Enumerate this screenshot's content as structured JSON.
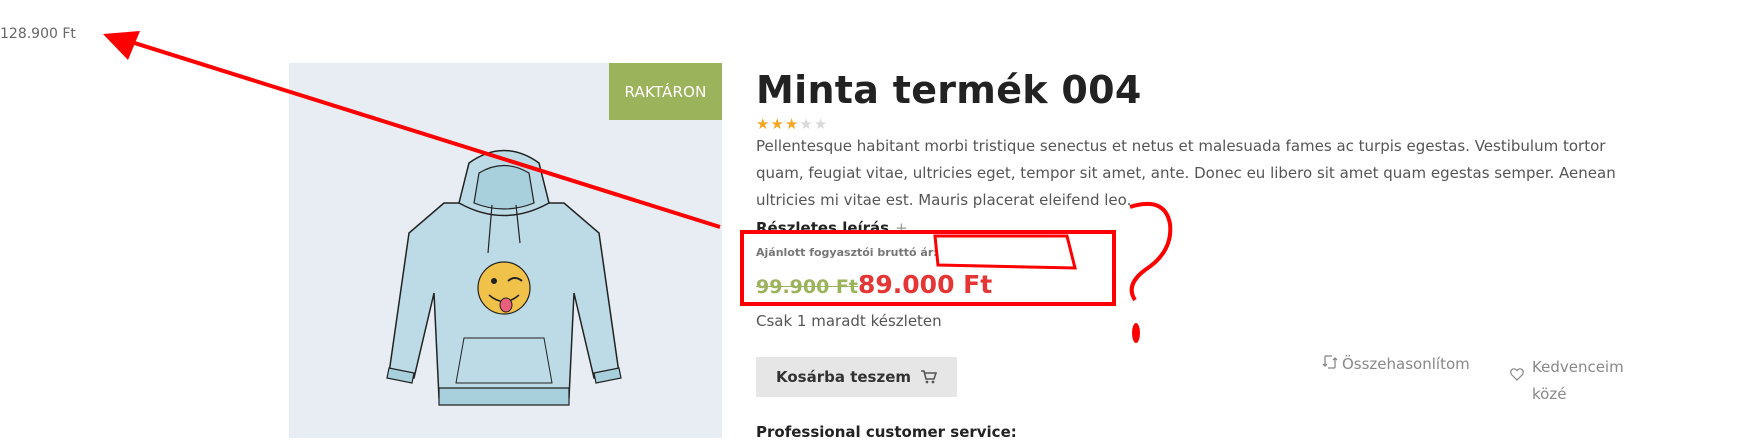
{
  "corner_price": "128.900 Ft",
  "product": {
    "stock_badge": "RAKTÁRON",
    "title": "Minta termék 004",
    "rating": 3,
    "rating_max": 5,
    "description": "Pellentesque habitant morbi tristique senectus et netus et malesuada fames ac turpis egestas. Vestibulum tortor quam, feugiat vitae, ultricies eget, tempor sit amet, ante. Donec eu libero sit amet quam egestas semper. Aenean ultricies mi vitae est. Mauris placerat eleifend leo.",
    "details_label": "Részletes leírás",
    "details_toggle": "+",
    "rrp_label": "Ajánlott fogyasztói bruttó ár:",
    "old_price": "99.900 Ft",
    "new_price": "89.000 Ft",
    "stock_note": "Csak 1 maradt készleten",
    "add_to_cart_label": "Kosárba teszem",
    "compare_label": "Összehasonlítom",
    "favorites_label": "Kedvenceim közé",
    "service_heading": "Professional customer service:"
  },
  "icons": {
    "cart": "cart-icon",
    "compare": "compare-icon",
    "favorites": "heart-icon"
  },
  "colors": {
    "stock_badge_bg": "#9bb35b",
    "old_price": "#9bb35b",
    "new_price": "#e53535",
    "annotation": "#ff0000",
    "image_bg": "#e7edf2"
  }
}
